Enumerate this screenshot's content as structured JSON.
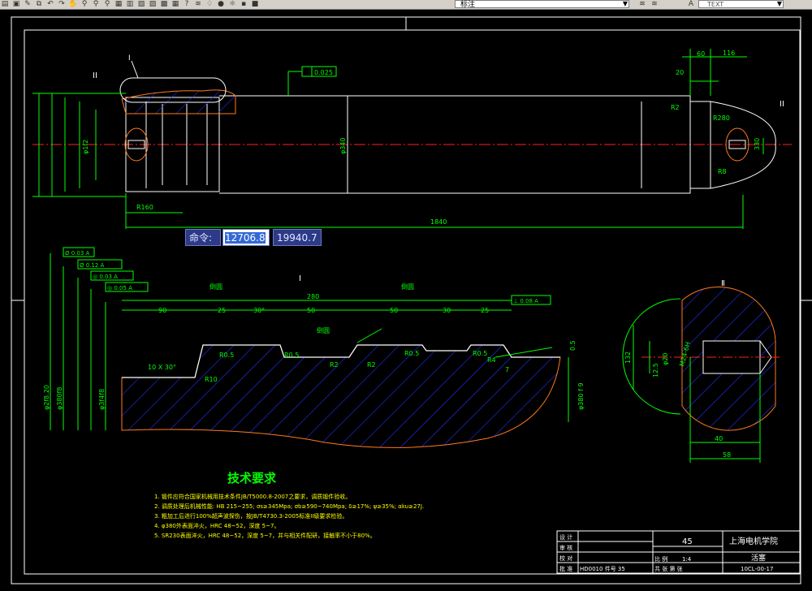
{
  "toolbar": {
    "layer_name": "标注",
    "text_style": "TEXT"
  },
  "command": {
    "label": "命令:",
    "x_value": "12706.8",
    "y_value": "19940.7"
  },
  "drawing": {
    "section_I_label": "I",
    "section_II_label": "II",
    "roman_I": "Ⅰ",
    "roman_II": "Ⅱ",
    "tolerance_top": "0.025",
    "dim_length_total": "1840",
    "dim_60": "60",
    "dim_116": "116",
    "dim_20": "20",
    "dim_r2": "R2",
    "dim_r8": "R8",
    "dim_r280": "R280",
    "dim_330": "330",
    "dim_1f2": "φ1f2",
    "dim_r160": "R160",
    "dim_a": "φ340",
    "tol_box_1": "Ø 0.03 A",
    "tol_box_2": "Ø 0.12 A",
    "tol_box_3": "◎ 0.03 A",
    "tol_box_4": "◎ 0.05 A",
    "tol_box_5": "⊥ 0.08 A",
    "dim_280": "280",
    "dim_90": "90",
    "dim_25a": "25",
    "dim_301": "30°",
    "dim_50a": "50",
    "dim_50b": "50",
    "dim_25b": "25",
    "dim_30": "30",
    "dim_r10": "R10",
    "dim_10x30": "10 X 30°",
    "dim_r05a": "R0.5",
    "dim_r05b": "R0.5",
    "dim_r2a": "R2",
    "dim_r2b": "R2",
    "dim_r05c": "R0.5",
    "dim_r05d": "R0.5",
    "dim_r4": "R4",
    "dim_7": "7",
    "dim_05": "0.5",
    "dim_phi_left1": "φ2f8.20",
    "dim_phi_left2": "φ380f8",
    "dim_phi_left3": "φ3f4f8",
    "dim_phi_right": "φ380 f 9",
    "weld_1": "倒圆",
    "weld_2": "倒圆",
    "weld_3": "倒圆",
    "dim_40": "40",
    "dim_58": "58",
    "dim_132": "132",
    "dim_125": "12.5",
    "dim_m24": "M24-6H",
    "dim_phi20": "φ20"
  },
  "tech_req": {
    "title": "技术要求",
    "items": [
      "1. 锻件应符合国家机械用技术条件JB/T5000.8-2007之要求，调质锻件验收。",
      "2. 调质处理后机械性能: HB 215~255; σs≥345Mpa; σb≥590~740Mpa; δ≥17%; ψ≥35%; αku≥27J.",
      "3. 粗加工后进行100%超声波探伤，按JB/T4730.3-2005标准II级要求检验。",
      "4. φ380外表面淬火，HRC 48~52，深度 5~7。",
      "5. SR230表面淬火，HRC 48~52，深度 5~7，并与相关件配研，接触率不小于80%。"
    ]
  },
  "title_block": {
    "material": "45",
    "school": "上海电机学院",
    "scale_label": "比 例",
    "scale_value": "1:4",
    "part_name": "活塞",
    "sheet_label": "共  张  第  张",
    "drawing_no": "10CL-00-17",
    "row_labels": [
      "设 计",
      "审 核",
      "校 对",
      "批 准"
    ],
    "bottom_row": "HD0010    件号    35"
  },
  "colors": {
    "background": "#000000",
    "outline": "#ffffff",
    "dimension": "#00ff00",
    "centerline": "#ff2020",
    "hatch": "#2020ff",
    "break_line": "#ff7a20",
    "callout": "#ffff00"
  }
}
